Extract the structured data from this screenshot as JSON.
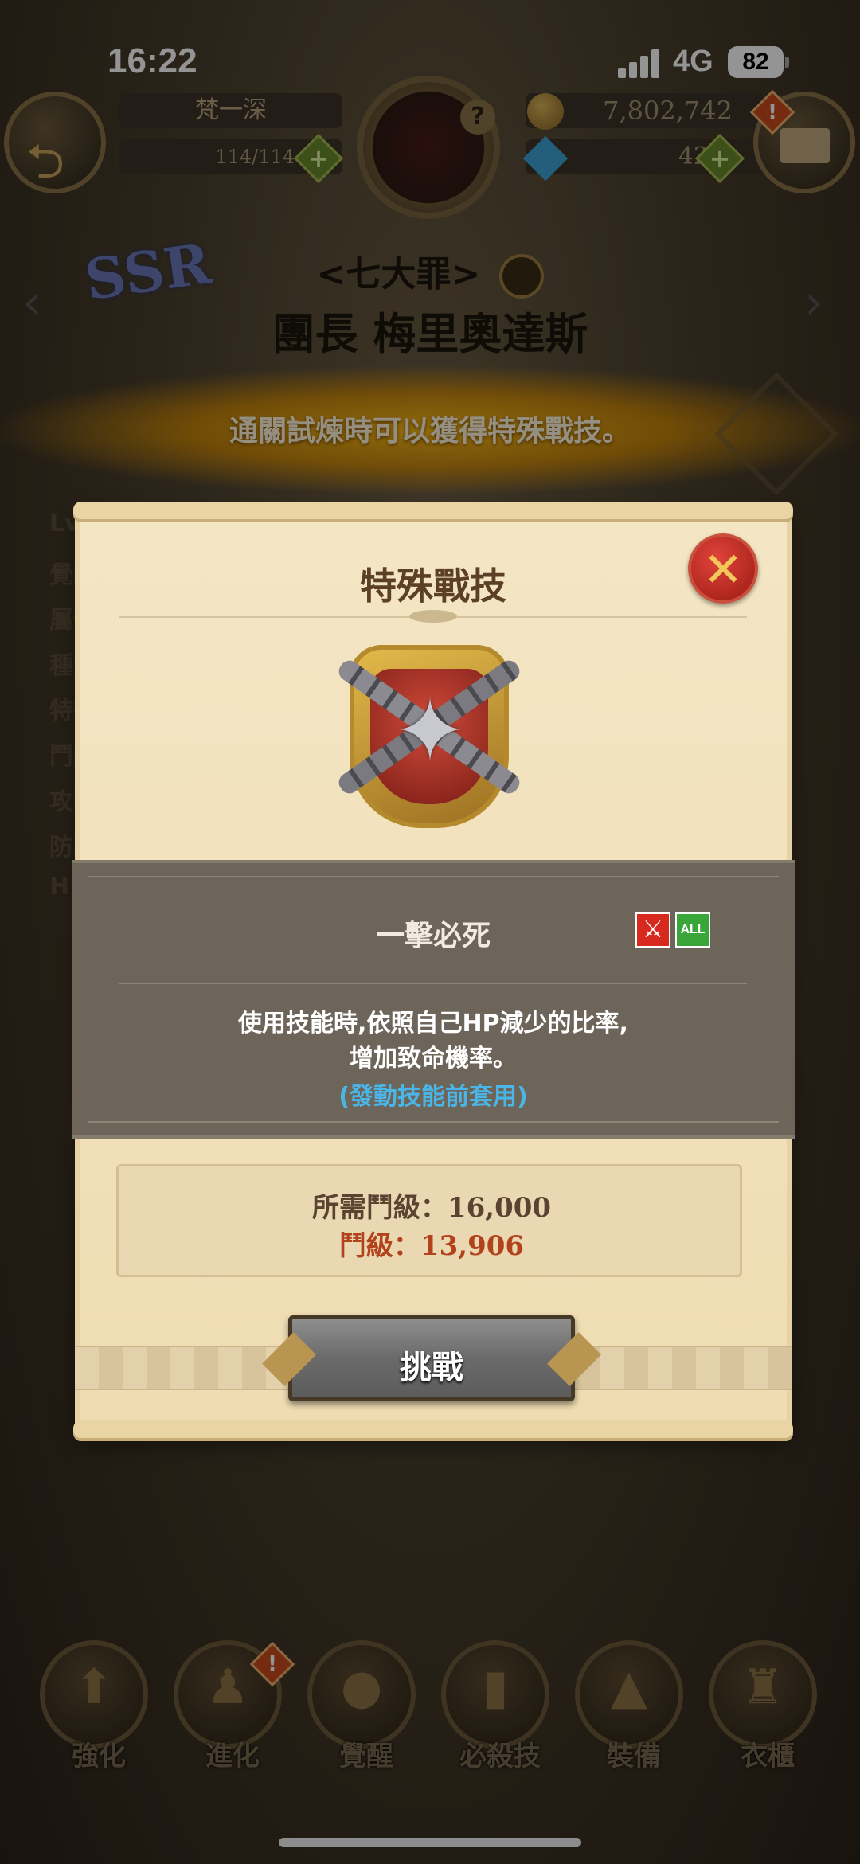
{
  "status_bar": {
    "time": "16:22",
    "network": "4G",
    "battery": "82"
  },
  "hud": {
    "player_name": "梵一深",
    "stamina": "114/114",
    "gold": "7,802,742",
    "gems": "42",
    "help_icon": "question-icon"
  },
  "character": {
    "rarity": "SSR",
    "group": "<七大罪>",
    "name": "團長 梅里奧達斯"
  },
  "banner": {
    "text": "通關試煉時可以獲得特殊戰技。"
  },
  "side_labels": [
    "Lv",
    "覺醒",
    "屬性",
    "種族",
    "特徵",
    "鬥級",
    "攻擊",
    "防禦",
    "HP"
  ],
  "modal": {
    "title": "特殊戰技",
    "skill_name": "一擊必死",
    "tag_all": "ALL",
    "description_line1": "使用技能時,依照自己HP減少的比率,",
    "description_line2": "增加致命機率。",
    "note": "(發動技能前套用)",
    "required_power": "所需鬥級：16,000",
    "current_power": "鬥級：13,906",
    "challenge_label": "挑戰",
    "colors": {
      "title": "#5b3f26",
      "note": "#4ab6e8",
      "current_power": "#b2421b"
    }
  },
  "bottom_menu": [
    {
      "label": "強化",
      "icon": "enhance-icon"
    },
    {
      "label": "進化",
      "icon": "evolve-icon"
    },
    {
      "label": "覺醒",
      "icon": "awaken-icon"
    },
    {
      "label": "必殺技",
      "icon": "ultimate-icon"
    },
    {
      "label": "裝備",
      "icon": "equipment-icon"
    },
    {
      "label": "衣櫃",
      "icon": "wardrobe-icon"
    }
  ]
}
